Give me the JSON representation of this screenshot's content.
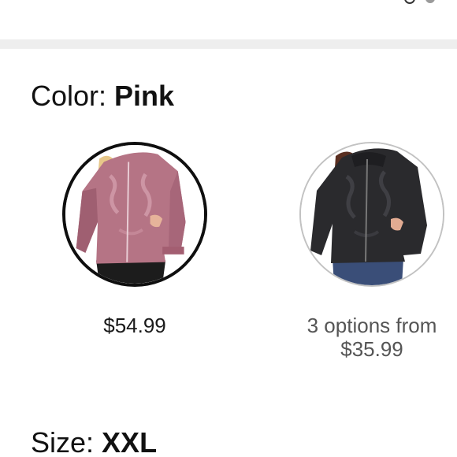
{
  "color_selector": {
    "label": "Color: ",
    "selected_value": "Pink",
    "options": [
      {
        "name": "Pink",
        "price_line": "$54.99",
        "selected": true,
        "garment_color": "#b57485"
      },
      {
        "name": "Black",
        "price_line1": "3 options from",
        "price_line2": "$35.99",
        "selected": false,
        "garment_color": "#2a2a2d"
      }
    ]
  },
  "size_selector": {
    "label": "Size: ",
    "selected_value": "XXL"
  },
  "colors": {
    "selected_ring": "#0f0f0f",
    "unselected_ring": "#c2c2c2",
    "divider": "#eeeeee",
    "secondary_text": "#555555"
  },
  "icons": {
    "top_right": "partial-icon"
  }
}
